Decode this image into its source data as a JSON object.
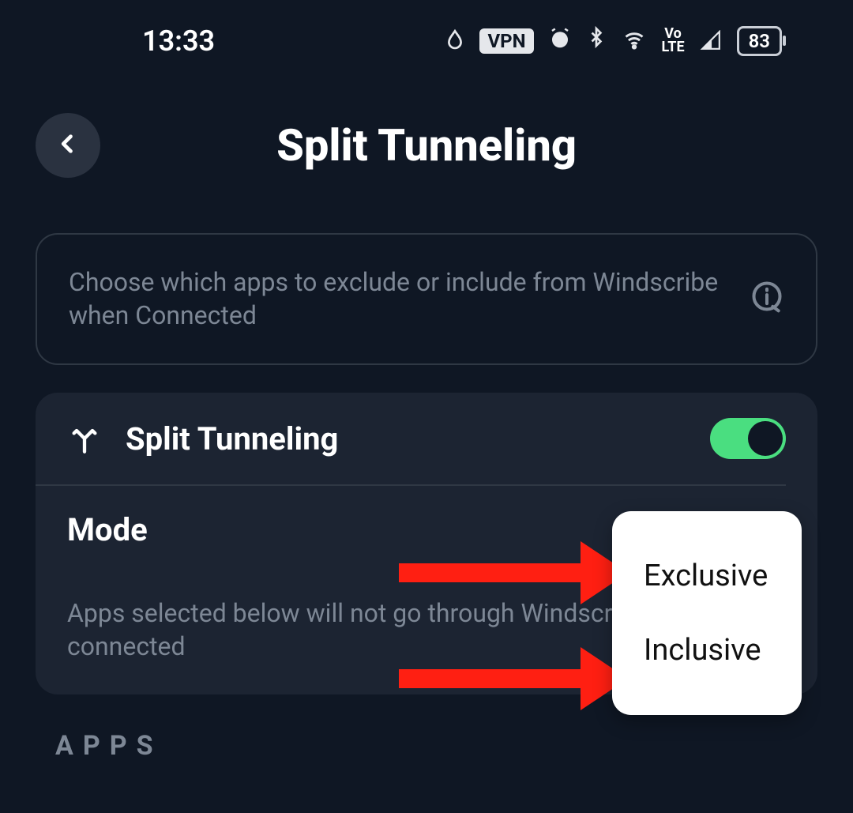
{
  "status": {
    "time": "13:33",
    "vpn": "VPN",
    "volte": "Vo\nLTE",
    "battery": "83"
  },
  "header": {
    "title": "Split Tunneling"
  },
  "info": {
    "text": "Choose which apps to exclude or include from Windscribe when Connected"
  },
  "settings": {
    "toggle_label": "Split Tunneling",
    "mode_label": "Mode",
    "description": "Apps selected below will not go through Windscribe wh connected",
    "dropdown": {
      "option1": "Exclusive",
      "option2": "Inclusive"
    }
  },
  "apps_header": "APPS"
}
